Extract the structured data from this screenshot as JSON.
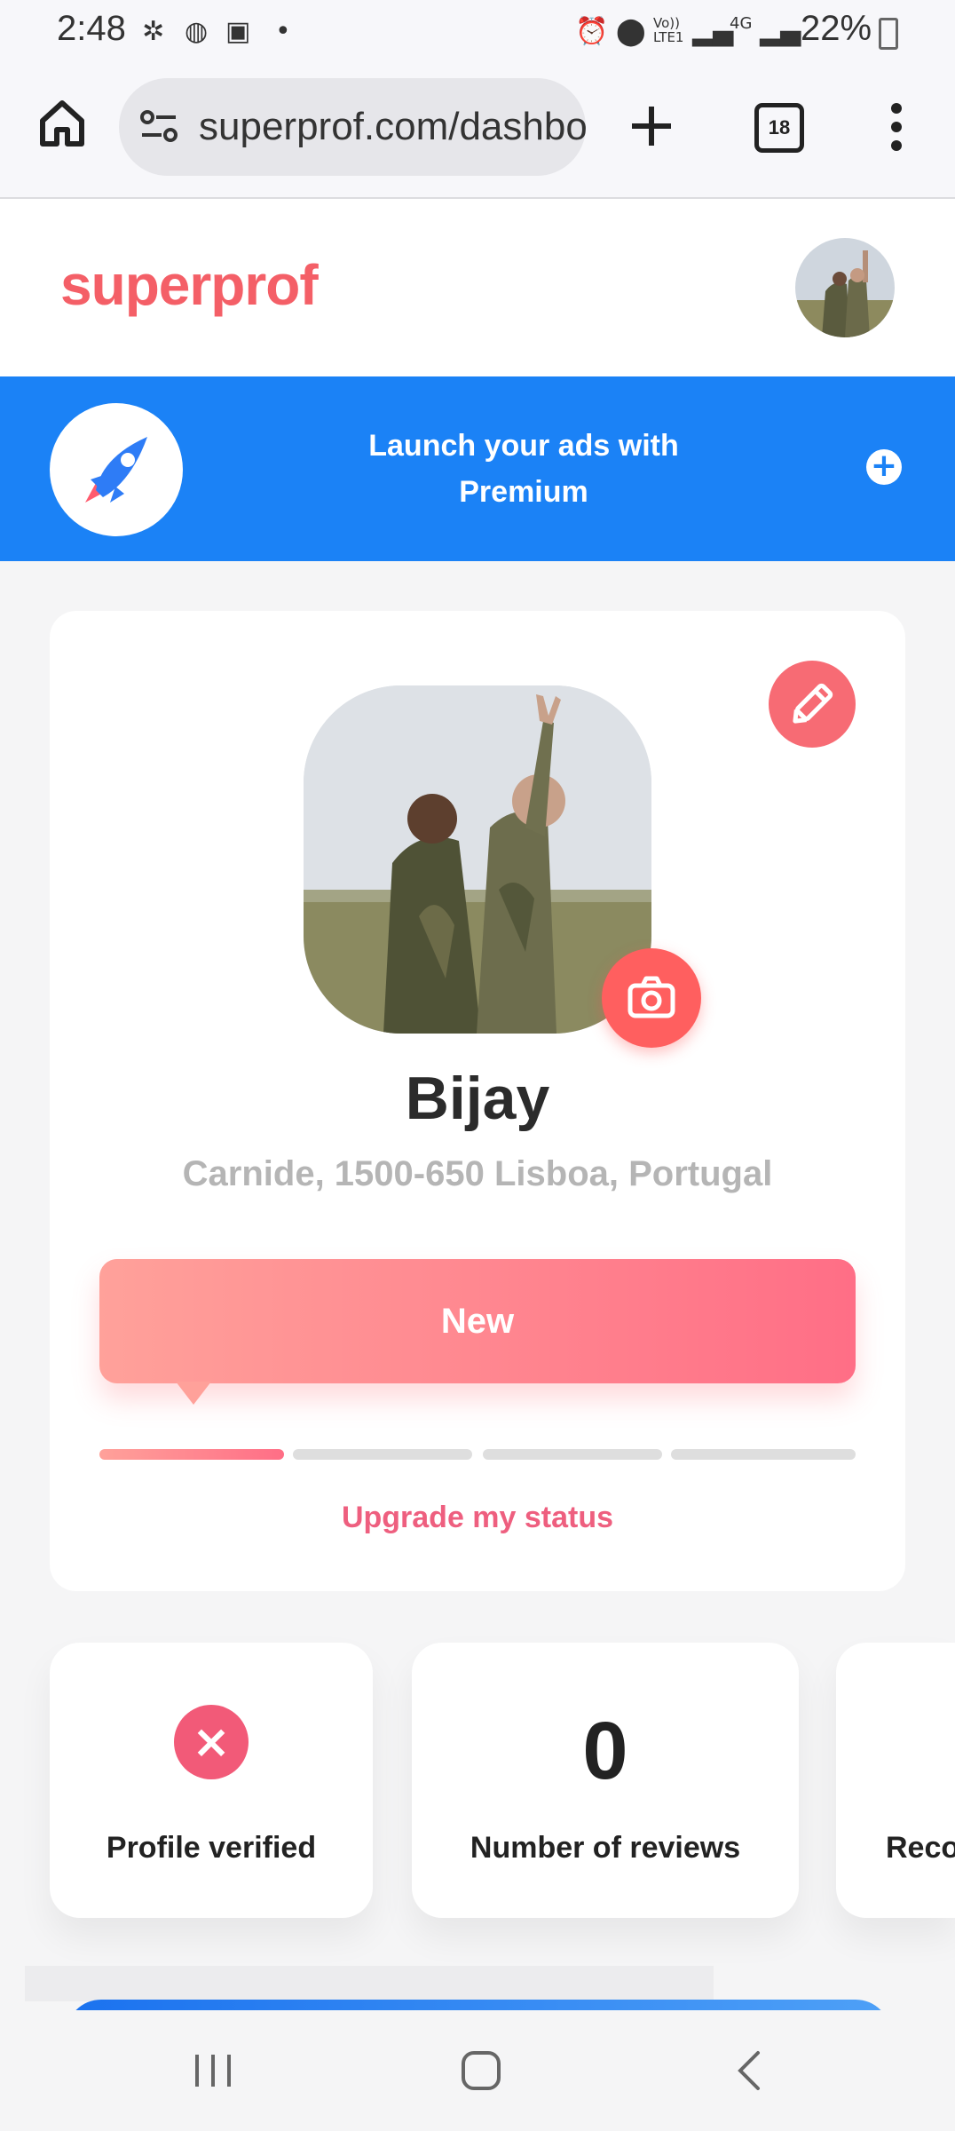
{
  "status_bar": {
    "time": "2:48",
    "net_label": "Vo)) LTE1",
    "lte_label": "4G",
    "battery": "22%"
  },
  "browser": {
    "url": "superprof.com/dashboard",
    "tab_count": "18"
  },
  "header": {
    "logo": "superprof"
  },
  "banner": {
    "line1": "Launch your ads with",
    "line2": "Premium",
    "accent_color": "#1b82f6"
  },
  "profile": {
    "name": "Bijay",
    "location": "Carnide, 1500-650 Lisboa, Portugal",
    "status_label": "New",
    "status_progress": 0.25,
    "upgrade_link": "Upgrade my status"
  },
  "stats": [
    {
      "label": "Profile verified",
      "icon": "x-circle-icon"
    },
    {
      "value": "0",
      "label": "Number of reviews"
    },
    {
      "label": "Reco"
    }
  ],
  "brand_color": "#f45f67"
}
